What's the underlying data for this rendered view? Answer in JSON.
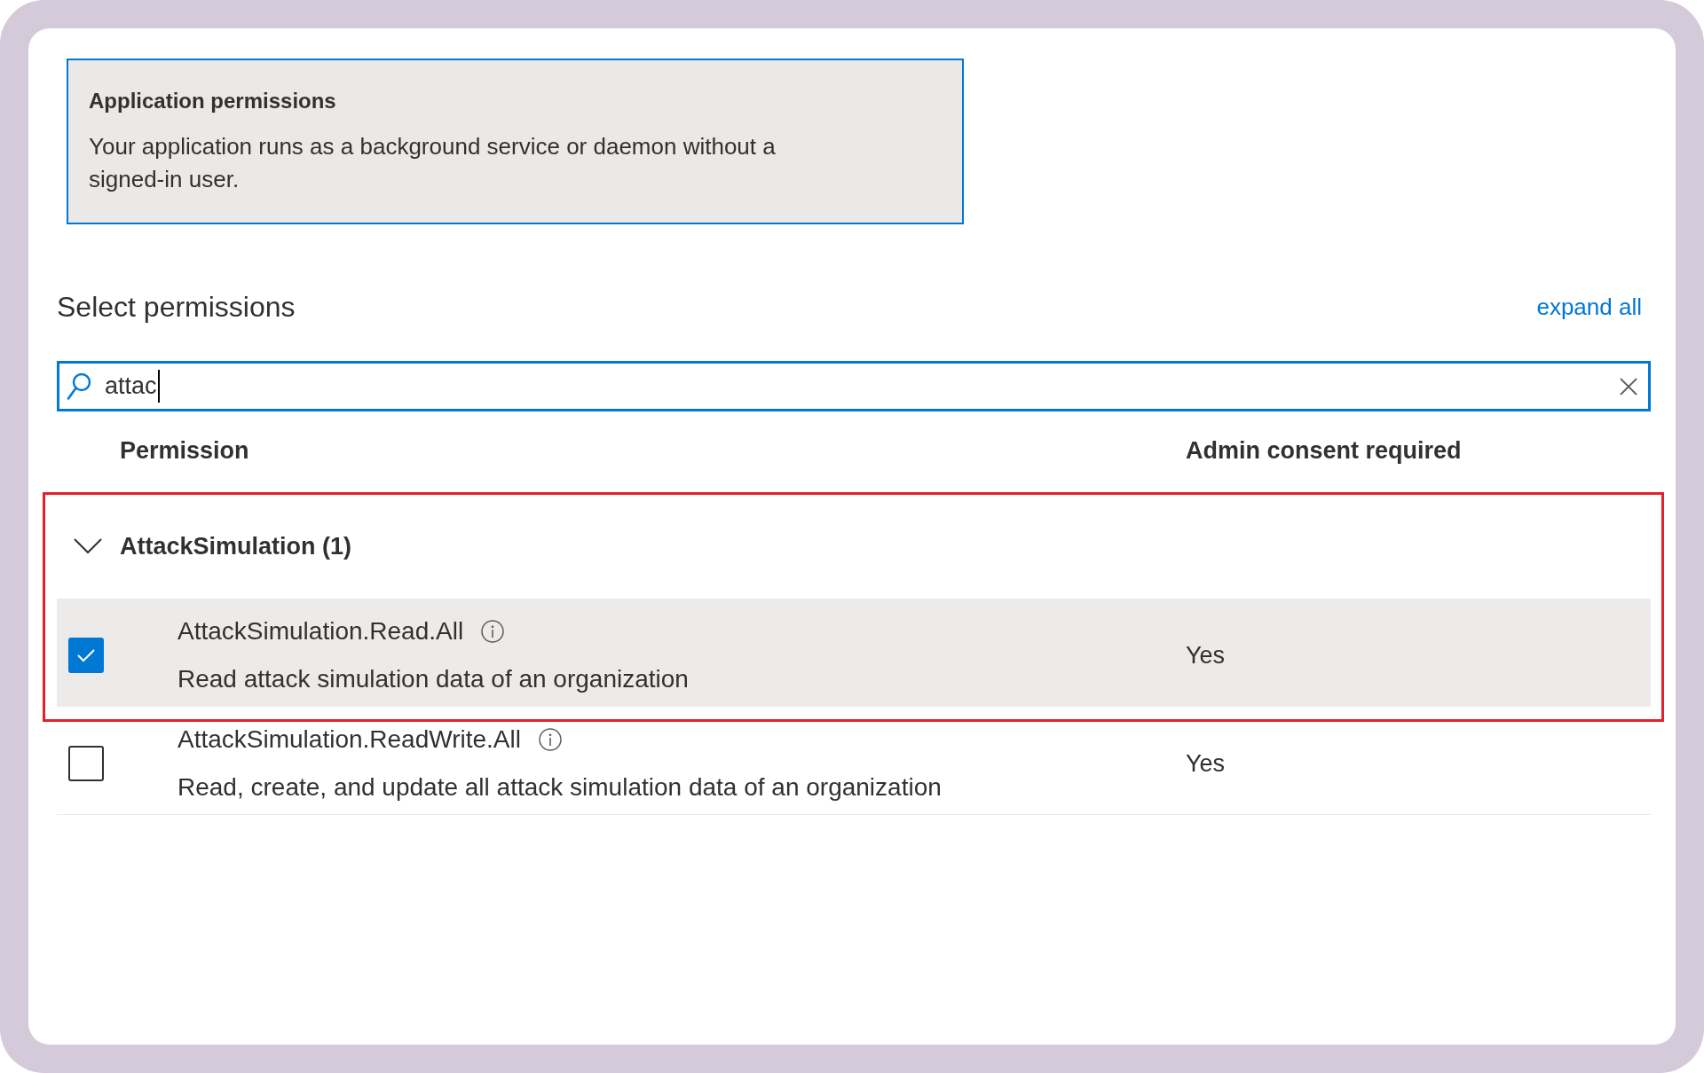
{
  "info_card": {
    "title": "Application permissions",
    "description": "Your application runs as a background service or daemon without a signed-in user.",
    "selected": true
  },
  "heading": "Select permissions",
  "expand_all_link": "expand all",
  "search": {
    "value": "attac",
    "focused": true
  },
  "columns": [
    "Permission",
    "Admin consent required"
  ],
  "groups": [
    {
      "name": "AttackSimulation (1)",
      "expanded": true,
      "highlighted": true,
      "permissions": [
        {
          "name": "AttackSimulation.Read.All",
          "description": "Read attack simulation data of an organization",
          "admin_consent": "Yes",
          "checked": true,
          "highlighted": true
        },
        {
          "name": "AttackSimulation.ReadWrite.All",
          "description": "Read, create, and update all attack simulation data of an organization",
          "admin_consent": "Yes",
          "checked": false,
          "highlighted": false
        }
      ]
    }
  ]
}
